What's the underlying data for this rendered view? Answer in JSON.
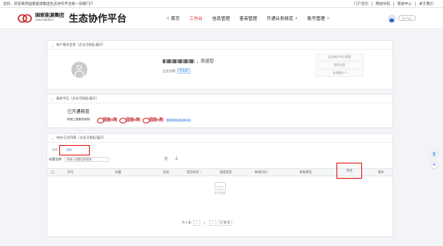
{
  "topbar": {
    "greeting": "您好，欢迎来到国家能源集团生态协作平台统一前端门户",
    "links": [
      "门户首页",
      "网站导航",
      "帮助中心",
      "关于我们"
    ]
  },
  "header": {
    "logo_cn": "国家能源集团",
    "logo_en": "CHN ENERGY",
    "platform": "生态协作平台",
    "nav": [
      {
        "label": "首页",
        "icon": "home-icon",
        "active": false
      },
      {
        "label": "工作台",
        "active": true
      },
      {
        "label": "信息管理",
        "active": false
      },
      {
        "label": "客商管理",
        "active": false
      },
      {
        "label": "开通业务频道",
        "chevron": true,
        "active": false
      },
      {
        "label": "账号管理",
        "chevron": true,
        "active": false
      }
    ],
    "user_name": "用户信息",
    "accent": "#d9302a"
  },
  "account_card": {
    "title": "账户基本信息（点击可收起/展开）",
    "welcome_suffix": "，欢迎您",
    "enterprise_label": "企业名称",
    "enterprise_tag": "已认证",
    "side_buttons": [
      "企业用户中心信息",
      "待办业务",
      "业务统计 0"
    ]
  },
  "service_card": {
    "title": "服务专区（点击可收起/展开）",
    "opened": "已开通频道",
    "logos_label": "物资工程服务采购：",
    "brands": [
      "国能e购",
      "国能e购",
      "国能e购"
    ],
    "extra_tag": "国家能源集团采购平台"
  },
  "todo_card": {
    "title": "待办/已办列表（点击可收起/展开）",
    "filter_label": "类别",
    "status_tag": "待办",
    "search_label": "标题名称",
    "search_placeholder": "请输入标题名称搜索",
    "columns": [
      "",
      "序号",
      "标题",
      "状态",
      "提交时间 ↓",
      "频道类型",
      "审核时间 ↓",
      "审核原因",
      "状态",
      "操作"
    ],
    "empty_text": "暂无数据",
    "pager": {
      "total": "共 0 条",
      "current": "1",
      "page_size": "10 条/页"
    }
  },
  "side_tools": {
    "tool1": "客",
    "tool2": "✲"
  }
}
